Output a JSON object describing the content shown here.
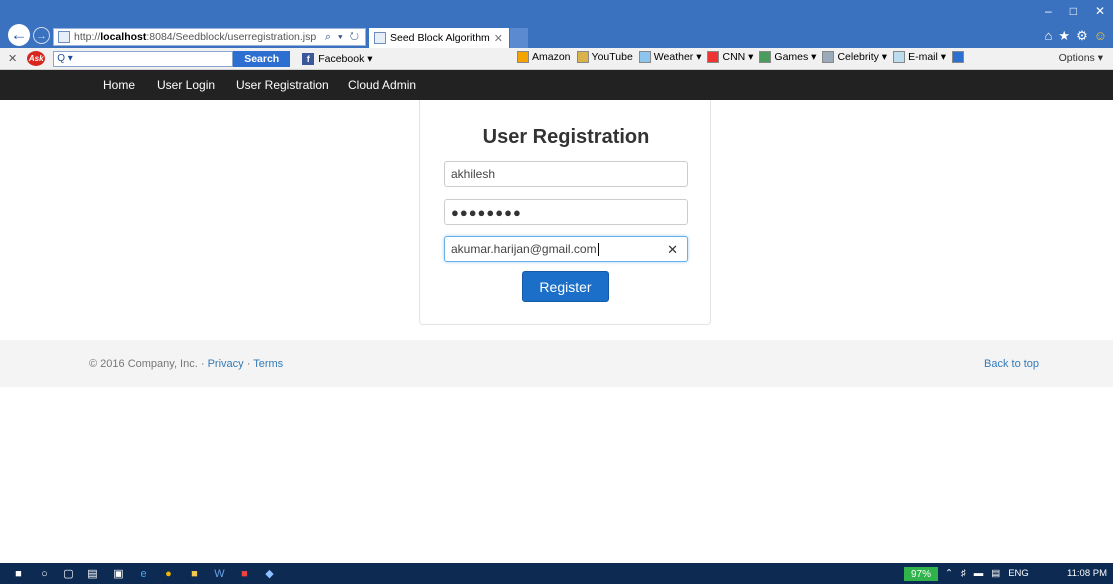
{
  "browser": {
    "address": {
      "prefix": "http://",
      "host": "localhost",
      "rest": ":8084/Seedblock/userregistration.jsp",
      "tools": "⌕ ▾ ↻"
    },
    "tab_title": "Seed Block Algorithm",
    "window_controls": [
      "–",
      "□",
      "✕"
    ],
    "right_icons": [
      "⌂",
      "★",
      "⚙",
      "☺"
    ]
  },
  "toolbar": {
    "search_placeholder": "Q ▾",
    "search_button": "Search",
    "facebook": "Facebook ▾",
    "links": [
      "Amazon",
      "YouTube",
      "Weather ▾",
      "CNN ▾",
      "Games ▾",
      "Celebrity ▾",
      "E-mail ▾"
    ],
    "options": "Options ▾"
  },
  "nav": {
    "home": "Home",
    "login": "User Login",
    "registration": "User Registration",
    "admin": "Cloud Admin"
  },
  "form": {
    "title": "User Registration",
    "username": "akhilesh",
    "password_mask": "●●●●●●●●",
    "email": "akumar.harijan@gmail.com",
    "clear_icon": "✕",
    "register_label": "Register"
  },
  "footer": {
    "copyright": "© 2016 Company, Inc. ·",
    "privacy": "Privacy",
    "sep": "·",
    "terms": "Terms",
    "back_to_top": "Back to top"
  },
  "taskbar": {
    "battery": "97%",
    "language": "ENG",
    "time": "11:08 PM"
  },
  "colors": {
    "ie_blue": "#3a72c0",
    "navbar": "#222222",
    "primary": "#1b6fc8",
    "link": "#337ab7",
    "taskbar": "#0c2a52"
  }
}
